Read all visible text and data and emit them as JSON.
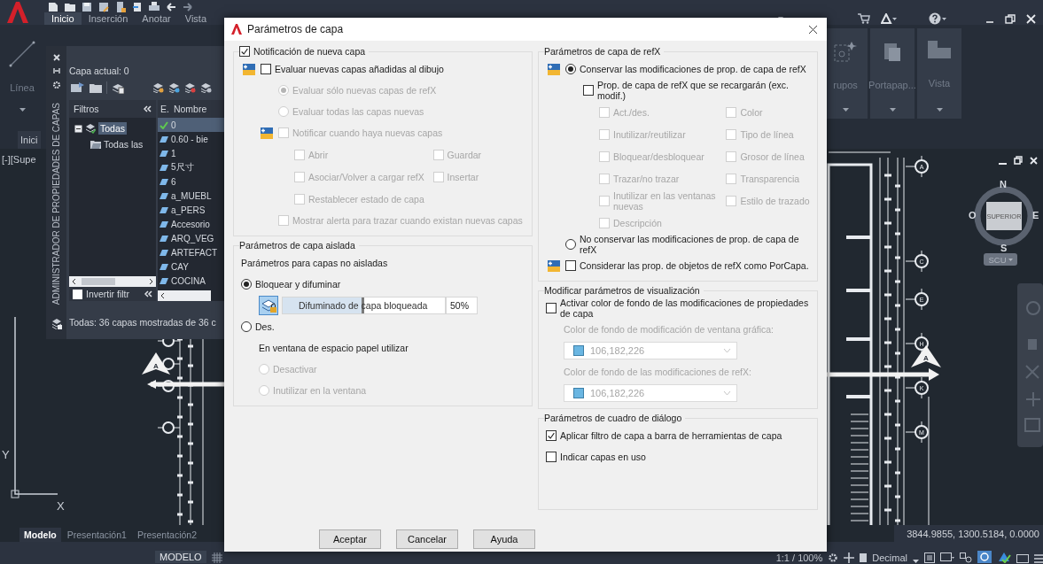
{
  "app": {
    "ribbon_tabs": [
      {
        "label": "Inicio",
        "selected": true
      },
      {
        "label": "Inserción",
        "selected": false
      },
      {
        "label": "Anotar",
        "selected": false
      },
      {
        "label": "Vista",
        "selected": false
      }
    ],
    "ribbon_panels": [
      {
        "label": "Línea"
      },
      {
        "label": "rupos"
      },
      {
        "label": "Portapap..."
      },
      {
        "label": "Vista"
      }
    ],
    "file_tab": "Inici",
    "viewport_label": "[-][Supe"
  },
  "layer_palette": {
    "title": "ADMINISTRADOR DE PROPIEDADES DE CAPAS",
    "current_layer": "Capa actual: 0",
    "filters_header": "Filtros",
    "filter_tree": [
      {
        "label": "Todas",
        "selected": true,
        "expanded": true,
        "children": [
          {
            "label": "Todas las",
            "selected": false
          }
        ]
      }
    ],
    "invert_filter": {
      "label": "Invertir filtr",
      "checked": false
    },
    "columns": [
      "E.",
      "Nombre"
    ],
    "layers": [
      {
        "name": "0",
        "current": true,
        "selected": true
      },
      {
        "name": "0.60 - bie",
        "current": false,
        "selected": false
      },
      {
        "name": "1",
        "current": false,
        "selected": false
      },
      {
        "name": "5尺寸",
        "current": false,
        "selected": false
      },
      {
        "name": "6",
        "current": false,
        "selected": false
      },
      {
        "name": "a_MUEBL",
        "current": false,
        "selected": false
      },
      {
        "name": "a_PERS",
        "current": false,
        "selected": false
      },
      {
        "name": "Accesorio",
        "current": false,
        "selected": false
      },
      {
        "name": "ARQ_VEG",
        "current": false,
        "selected": false
      },
      {
        "name": "ARTEFACT",
        "current": false,
        "selected": false
      },
      {
        "name": "CAY",
        "current": false,
        "selected": false
      },
      {
        "name": "COCINA",
        "current": false,
        "selected": false
      }
    ],
    "status": "Todas: 36 capas mostradas de 36 c"
  },
  "dialog": {
    "title": "Parámetros de capa",
    "columns": [
      [
        {
          "legend": {
            "kind": "checkbox",
            "label": "Notificación de nueva capa",
            "checked": true,
            "disabled": false
          },
          "items": [
            {
              "kind": "checkbox",
              "label": "Evaluar nuevas capas añadidas al dibujo",
              "checked": false,
              "disabled": false,
              "icon": true,
              "children": [
                {
                  "kind": "radio",
                  "label": "Evaluar sólo nuevas capas de refX",
                  "selected": true,
                  "disabled": true
                },
                {
                  "kind": "radio",
                  "label": "Evaluar todas las capas nuevas",
                  "selected": false,
                  "disabled": true
                },
                {
                  "kind": "checkbox",
                  "label": "Notificar cuando haya nuevas capas",
                  "checked": false,
                  "disabled": true,
                  "icon": true,
                  "options": [
                    {
                      "label": "Abrir",
                      "checked": false,
                      "disabled": true
                    },
                    {
                      "label": "Guardar",
                      "checked": false,
                      "disabled": true
                    },
                    {
                      "label": "Asociar/Volver a cargar refX",
                      "checked": false,
                      "disabled": true
                    },
                    {
                      "label": "Insertar",
                      "checked": false,
                      "disabled": true
                    },
                    {
                      "label": "Restablecer estado de capa",
                      "checked": false,
                      "disabled": true
                    }
                  ]
                },
                {
                  "kind": "checkbox",
                  "label": "Mostrar alerta para trazar cuando existan nuevas capas",
                  "checked": false,
                  "disabled": true
                }
              ]
            }
          ]
        },
        {
          "legend": {
            "kind": "text",
            "label": "Parámetros de capa aislada"
          },
          "items": [
            {
              "kind": "text",
              "label": "Parámetros para capas no aisladas",
              "disabled": false
            },
            {
              "kind": "radio",
              "label": "Bloquear y difuminar",
              "selected": true,
              "disabled": false,
              "children": [
                {
                  "kind": "slider",
                  "label": "Difuminado de capa bloqueada",
                  "level": 0.5,
                  "reading": "50%"
                }
              ]
            },
            {
              "kind": "radio",
              "label": "Des.",
              "selected": false,
              "disabled": false,
              "children": [
                {
                  "kind": "text",
                  "label": "En ventana de espacio papel utilizar",
                  "disabled": false
                },
                {
                  "kind": "radio",
                  "label": "Desactivar",
                  "selected": false,
                  "disabled": true
                },
                {
                  "kind": "radio",
                  "label": "Inutilizar en la ventana",
                  "selected": false,
                  "disabled": true
                }
              ]
            }
          ]
        }
      ],
      [
        {
          "legend": {
            "kind": "text",
            "label": "Parámetros de capa de refX"
          },
          "items": [
            {
              "kind": "radio",
              "label": "Conservar las modificaciones de prop. de capa de refX",
              "selected": true,
              "disabled": false,
              "icon": true,
              "children": [
                {
                  "kind": "checkbox",
                  "label": "Prop. de capa de refX que se recargarán (exc. modif.)",
                  "checked": false,
                  "disabled": false,
                  "options": [
                    {
                      "label": "Act./des.",
                      "checked": false,
                      "disabled": true
                    },
                    {
                      "label": "Color",
                      "checked": false,
                      "disabled": true
                    },
                    {
                      "label": "Inutilizar/reutilizar",
                      "checked": false,
                      "disabled": true
                    },
                    {
                      "label": "Tipo de línea",
                      "checked": false,
                      "disabled": true
                    },
                    {
                      "label": "Bloquear/desbloquear",
                      "checked": false,
                      "disabled": true
                    },
                    {
                      "label": "Grosor de línea",
                      "checked": false,
                      "disabled": true
                    },
                    {
                      "label": "Trazar/no trazar",
                      "checked": false,
                      "disabled": true
                    },
                    {
                      "label": "Transparencia",
                      "checked": false,
                      "disabled": true
                    },
                    {
                      "label": "Inutilizar en las ventanas nuevas",
                      "checked": false,
                      "disabled": true
                    },
                    {
                      "label": "Estilo de trazado",
                      "checked": false,
                      "disabled": true
                    },
                    {
                      "label": "Descripción",
                      "checked": false,
                      "disabled": true
                    }
                  ]
                }
              ]
            },
            {
              "kind": "radio",
              "label": "No conservar las modificaciones de prop. de capa de refX",
              "selected": false,
              "disabled": false
            },
            {
              "kind": "checkbox",
              "label": "Considerar las prop. de objetos de refX como PorCapa.",
              "checked": false,
              "disabled": false,
              "icon": true
            }
          ]
        },
        {
          "legend": {
            "kind": "text",
            "label": "Modificar parámetros de visualización"
          },
          "items": [
            {
              "kind": "checkbox",
              "label": "Activar color de fondo de las modificaciones de propiedades de capa",
              "checked": false,
              "disabled": false,
              "children": [
                {
                  "kind": "text",
                  "label": "Color de fondo de modificación de ventana gráfica:",
                  "disabled": true
                },
                {
                  "kind": "dropdown",
                  "value": "106,182,226",
                  "color": "#6ab6e2",
                  "disabled": true
                },
                {
                  "kind": "text",
                  "label": "Color de fondo de las modificaciones de refX:",
                  "disabled": true
                },
                {
                  "kind": "dropdown",
                  "value": "106,182,226",
                  "color": "#6ab6e2",
                  "disabled": true
                }
              ]
            }
          ]
        },
        {
          "legend": {
            "kind": "text",
            "label": "Parámetros de cuadro de diálogo"
          },
          "items": [
            {
              "kind": "checkbox",
              "label": "Aplicar filtro de capa a barra de herramientas de capa",
              "checked": true,
              "disabled": false
            },
            {
              "kind": "checkbox",
              "label": "Indicar capas en uso",
              "checked": false,
              "disabled": false
            }
          ]
        }
      ]
    ],
    "buttons": [
      {
        "label": "Aceptar"
      },
      {
        "label": "Cancelar"
      },
      {
        "label": "Ayuda"
      }
    ]
  },
  "drawing": {
    "grid_markers": [
      "A",
      "C",
      "E",
      "H",
      "K",
      "M"
    ],
    "section_marks": [
      "A",
      "A"
    ]
  },
  "ucs": {
    "y_label": "Y",
    "x_label": "X"
  },
  "viewcube": {
    "north": "N",
    "west": "O",
    "east": "E",
    "south": "S",
    "face": "SUPERIOR",
    "ucs_menu": "SCU"
  },
  "layout_tabs": [
    {
      "label": "Modelo",
      "selected": true
    },
    {
      "label": "Presentación1",
      "selected": false
    },
    {
      "label": "Presentación2",
      "selected": false
    }
  ],
  "coordinates": "3844.9855, 1300.5184, 0.0000",
  "status_bar": {
    "space": "MODELO",
    "scale": "1:1 / 100%",
    "units": "Decimal"
  }
}
